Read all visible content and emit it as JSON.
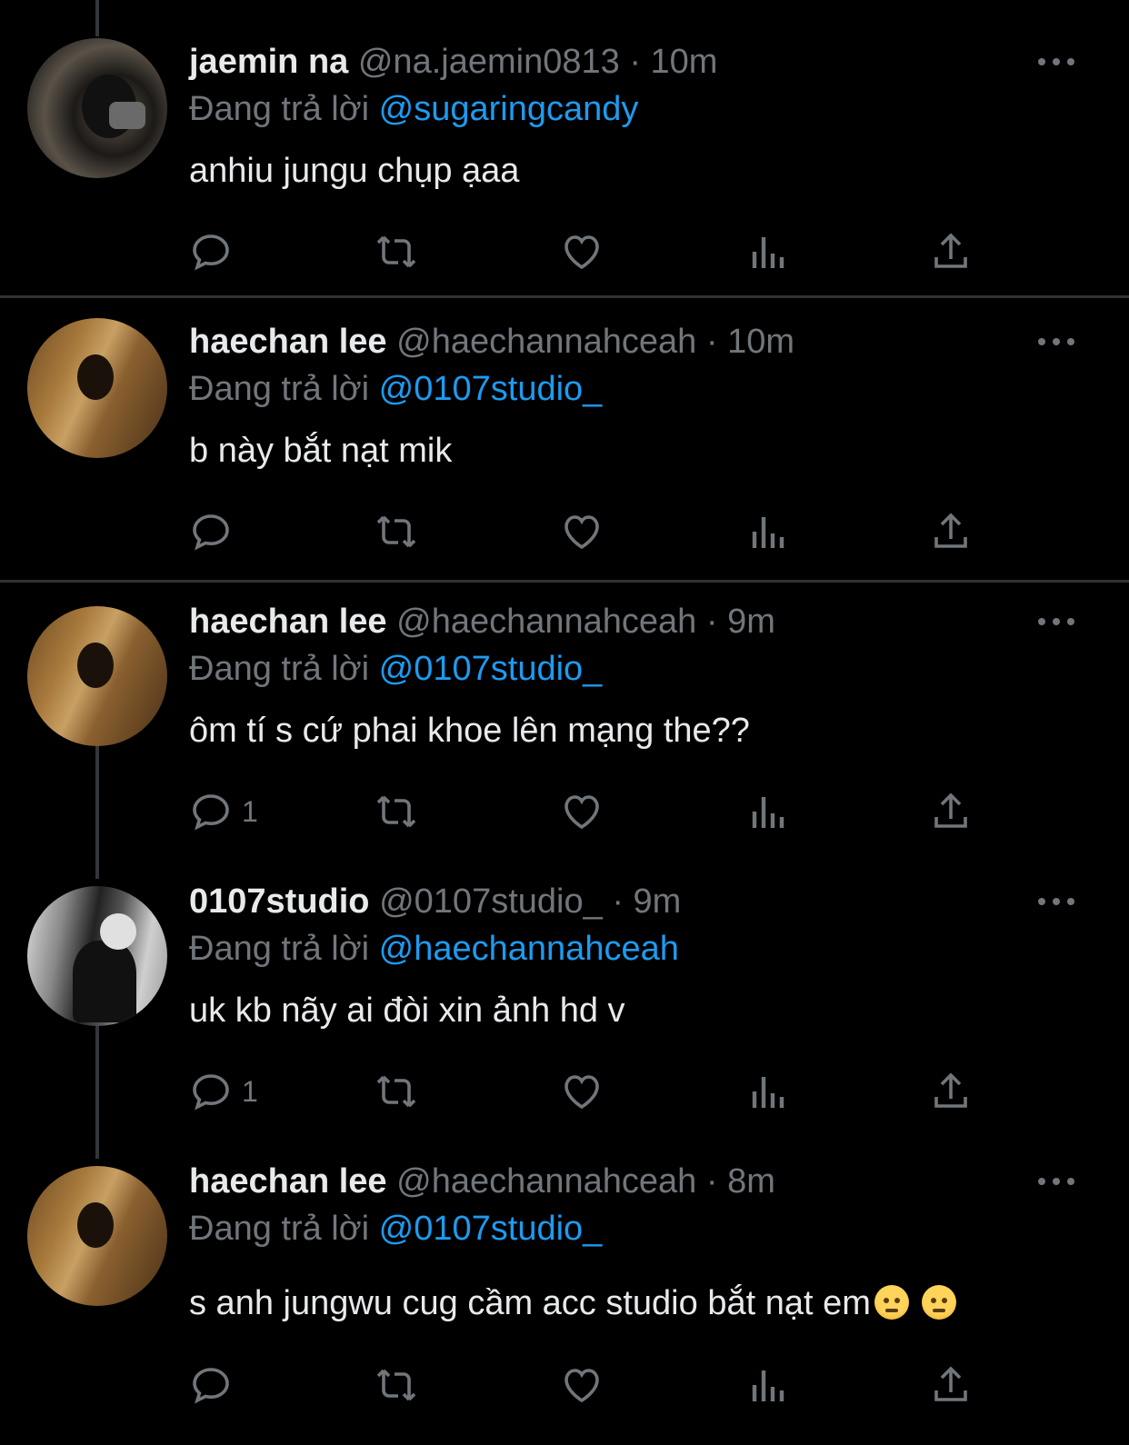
{
  "reply_prefix": "Đang trả lời",
  "tweets": [
    {
      "name": "jaemin na",
      "handle": "@na.jaemin0813",
      "sep": "·",
      "time": "10m",
      "reply_to": "@sugaringcandy",
      "text": "anhiu jungu chụp ạaa",
      "reply_count": ""
    },
    {
      "name": "haechan lee",
      "handle": "@haechannahceah",
      "sep": "·",
      "time": "10m",
      "reply_to": "@0107studio_",
      "text": "b này bắt nạt mik",
      "reply_count": ""
    },
    {
      "name": "haechan lee",
      "handle": "@haechannahceah",
      "sep": "·",
      "time": "9m",
      "reply_to": "@0107studio_",
      "text": "ôm tí s cứ phai khoe lên mạng the??",
      "reply_count": "1"
    },
    {
      "name": "0107studio",
      "handle": "@0107studio_",
      "sep": "·",
      "time": "9m",
      "reply_to": "@haechannahceah",
      "text": "uk kb nãy ai đòi xin ảnh hd v",
      "reply_count": "1"
    },
    {
      "name": "haechan lee",
      "handle": "@haechannahceah",
      "sep": "·",
      "time": "8m",
      "reply_to": "@0107studio_",
      "text": "s anh jungwu cug cầm acc studio bắt nạt em",
      "reply_count": ""
    }
  ],
  "colors": {
    "background": "#000000",
    "text": "#e7e9ea",
    "muted": "#71767b",
    "accent": "#1d9bf0",
    "divider": "#2f3336"
  },
  "icons": [
    "reply-icon",
    "retweet-icon",
    "like-icon",
    "views-icon",
    "share-icon",
    "more-icon",
    "angry-face-emoji"
  ]
}
